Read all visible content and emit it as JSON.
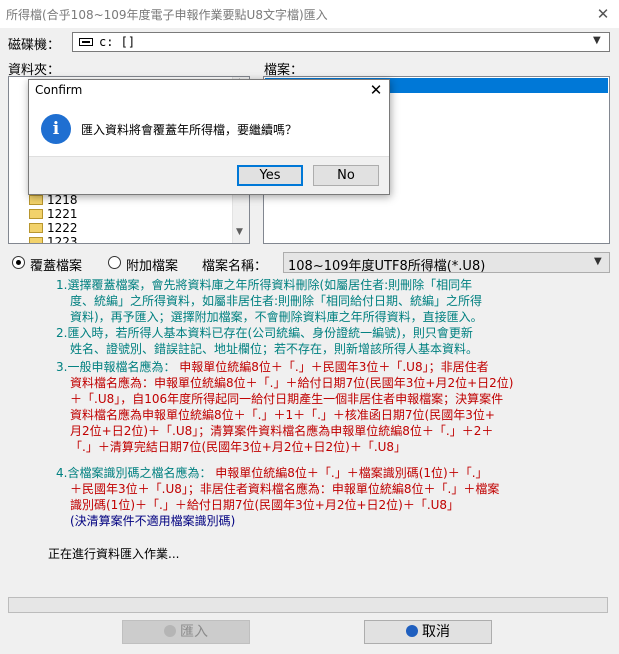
{
  "window": {
    "title": "所得檔(合乎108~109年度電子申報作業要點U8文字檔)匯入",
    "close_glyph": "✕"
  },
  "drive": {
    "label": "磁碟機：",
    "value": "c: []",
    "icon": "drive-icon"
  },
  "folder": {
    "label": "資料夾：",
    "items": [
      "1218",
      "1221",
      "1222",
      "1223"
    ]
  },
  "files": {
    "label": "檔案："
  },
  "options": {
    "overwrite_label": "覆蓋檔案",
    "append_label": "附加檔案",
    "selected": "overwrite",
    "filename_label": "檔案名稱：",
    "filename_value": "108~109年度UTF8所得檔(*.U8)"
  },
  "instructions": {
    "p1": [
      "1.選擇覆蓋檔案，會先將資料庫之年所得資料刪除(如屬居住者:則刪除「相同年",
      "度、統編」之所得資料，如屬非居住者:則刪除「相同給付日期、統編」之所得",
      "資料)，再予匯入；選擇附加檔案，不會刪除資料庫之年所得資料，直接匯入。"
    ],
    "p2": [
      "2.匯入時，若所得人基本資料已存在(公司統編、身份證統一編號)，則只會更新",
      "姓名、證號別、錯誤註記、地址欄位；若不存在，則新增該所得人基本資料。"
    ],
    "p3_prefix": "3.一般申報檔名應為：",
    "p3": [
      "申報單位統編8位＋「.」＋民國年3位＋「.U8」；非居住者",
      "資料檔名應為：申報單位統編8位＋「.」＋給付日期7位(民國年3位+月2位+日2位)",
      "＋「.U8」，自106年度所得起同一給付日期產生一個非居住者申報檔案；決算案件",
      "資料檔名應為申報單位統編8位＋「.」＋1＋「.」＋核准函日期7位(民國年3位+",
      "月2位+日2位)＋「.U8」；清算案件資料檔名應為申報單位統編8位＋「.」＋2＋",
      "「.」＋清算完結日期7位(民國年3位+月2位+日2位)＋「.U8」"
    ],
    "p4_prefix": "4.含檔案識別碼之檔名應為：",
    "p4": [
      "申報單位統編8位＋「.」＋檔案識別碼(1位)＋「.」",
      "＋民國年3位＋「.U8」；非居住者資料檔名應為：申報單位統編8位＋「.」＋檔案",
      "識別碼(1位)＋「.」＋給付日期7位(民國年3位+月2位+日2位)＋「.U8」"
    ],
    "p4_note": "(決清算案件不適用檔案識別碼)"
  },
  "status": "正在進行資料匯入作業...",
  "progress": 0,
  "buttons": {
    "import": "匯入",
    "cancel": "取消"
  },
  "dialog": {
    "title": "Confirm",
    "close_glyph": "✕",
    "icon_glyph": "i",
    "message": "匯入資料將會覆蓋年所得檔，要繼續嗎？",
    "yes": "Yes",
    "no": "No"
  },
  "colors": {
    "teal": "#008080",
    "red": "#c00000",
    "navy": "#000080",
    "selection": "#0078d7"
  }
}
